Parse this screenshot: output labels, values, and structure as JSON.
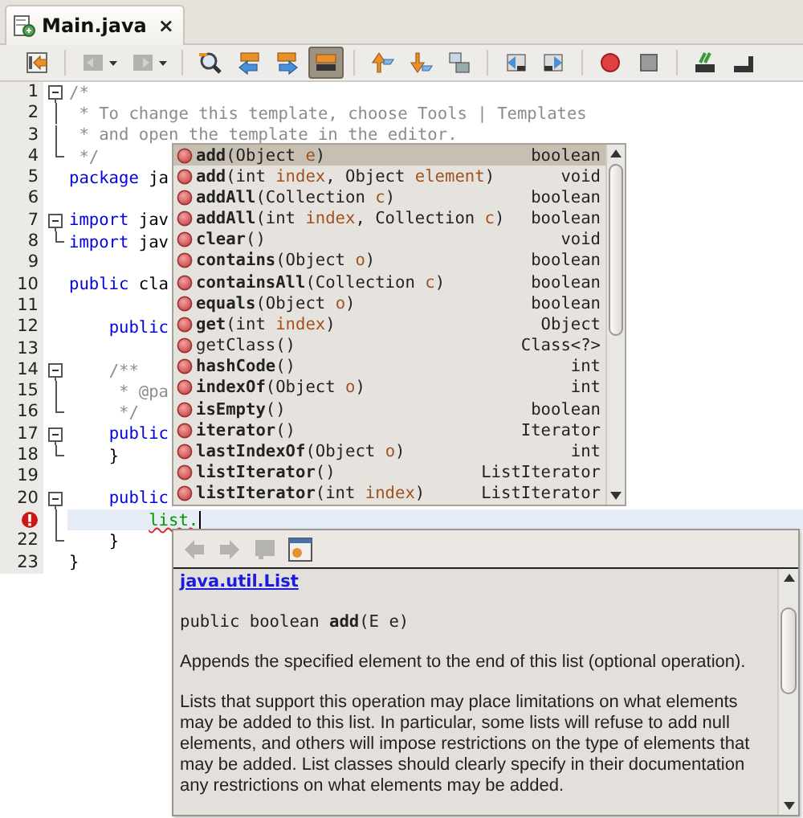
{
  "tab": {
    "title": "Main.java",
    "close": "×",
    "selected": true
  },
  "toolbar": [
    {
      "kind": "button",
      "pressed": false,
      "disabled": false
    },
    {
      "kind": "separator"
    },
    {
      "kind": "dropdown",
      "pressed": false,
      "disabled": true
    },
    {
      "kind": "dropdown",
      "pressed": false,
      "disabled": true
    },
    {
      "kind": "separator"
    },
    {
      "kind": "button",
      "pressed": false,
      "disabled": false
    },
    {
      "kind": "button",
      "pressed": false,
      "disabled": false
    },
    {
      "kind": "button",
      "pressed": false,
      "disabled": false
    },
    {
      "kind": "button",
      "pressed": true,
      "disabled": false
    },
    {
      "kind": "separator"
    },
    {
      "kind": "button",
      "pressed": false,
      "disabled": false
    },
    {
      "kind": "button",
      "pressed": false,
      "disabled": false
    },
    {
      "kind": "button",
      "pressed": false,
      "disabled": false
    },
    {
      "kind": "separator"
    },
    {
      "kind": "button",
      "pressed": false,
      "disabled": false
    },
    {
      "kind": "button",
      "pressed": false,
      "disabled": false
    },
    {
      "kind": "separator"
    },
    {
      "kind": "button",
      "pressed": false,
      "disabled": false
    },
    {
      "kind": "button",
      "pressed": false,
      "disabled": false
    },
    {
      "kind": "separator"
    },
    {
      "kind": "button",
      "pressed": false,
      "disabled": false
    },
    {
      "kind": "button",
      "pressed": false,
      "disabled": false
    }
  ],
  "editor": {
    "lines": [
      {
        "number": "1",
        "fold": {
          "kind": "start"
        },
        "current": false,
        "error": false,
        "tokens": [
          {
            "text": "/*",
            "kind": "comment"
          }
        ]
      },
      {
        "number": "2",
        "fold": {
          "kind": "line"
        },
        "current": false,
        "error": false,
        "tokens": [
          {
            "text": " * To change this template, choose Tools | Templates",
            "kind": "comment"
          }
        ]
      },
      {
        "number": "3",
        "fold": {
          "kind": "line"
        },
        "current": false,
        "error": false,
        "tokens": [
          {
            "text": " * and open the template in the editor.",
            "kind": "comment"
          }
        ]
      },
      {
        "number": "4",
        "fold": {
          "kind": "end"
        },
        "current": false,
        "error": false,
        "tokens": [
          {
            "text": " */",
            "kind": "comment"
          }
        ]
      },
      {
        "number": "5",
        "current": false,
        "error": false,
        "tokens": [
          {
            "text": "package",
            "kind": "keyword"
          },
          {
            "text": " ja",
            "kind": "plain"
          }
        ]
      },
      {
        "number": "6",
        "current": false,
        "error": false
      },
      {
        "number": "7",
        "fold": {
          "kind": "start"
        },
        "current": false,
        "error": false,
        "tokens": [
          {
            "text": "import",
            "kind": "keyword"
          },
          {
            "text": " jav",
            "kind": "plain"
          }
        ]
      },
      {
        "number": "8",
        "fold": {
          "kind": "end"
        },
        "current": false,
        "error": false,
        "tokens": [
          {
            "text": "import",
            "kind": "keyword"
          },
          {
            "text": " jav",
            "kind": "plain"
          }
        ]
      },
      {
        "number": "9",
        "current": false,
        "error": false
      },
      {
        "number": "10",
        "current": false,
        "error": false,
        "tokens": [
          {
            "text": "public",
            "kind": "keyword"
          },
          {
            "text": " cla",
            "kind": "plain"
          }
        ]
      },
      {
        "number": "11",
        "current": false,
        "error": false
      },
      {
        "number": "12",
        "current": false,
        "error": false,
        "tokens": [
          {
            "text": "    public",
            "kind": "keyword"
          }
        ]
      },
      {
        "number": "13",
        "current": false,
        "error": false
      },
      {
        "number": "14",
        "fold": {
          "kind": "start"
        },
        "current": false,
        "error": false,
        "tokens": [
          {
            "text": "    /**",
            "kind": "comment"
          }
        ]
      },
      {
        "number": "15",
        "fold": {
          "kind": "line"
        },
        "current": false,
        "error": false,
        "tokens": [
          {
            "text": "     * @pa",
            "kind": "comment"
          }
        ]
      },
      {
        "number": "16",
        "fold": {
          "kind": "end"
        },
        "current": false,
        "error": false,
        "tokens": [
          {
            "text": "     */",
            "kind": "comment"
          }
        ]
      },
      {
        "number": "17",
        "fold": {
          "kind": "start"
        },
        "current": false,
        "error": false,
        "tokens": [
          {
            "text": "    public",
            "kind": "keyword"
          }
        ]
      },
      {
        "number": "18",
        "fold": {
          "kind": "end"
        },
        "current": false,
        "error": false,
        "tokens": [
          {
            "text": "    }",
            "kind": "plain"
          }
        ]
      },
      {
        "number": "19",
        "current": false,
        "error": false
      },
      {
        "number": "20",
        "fold": {
          "kind": "start"
        },
        "current": false,
        "error": false,
        "tokens": [
          {
            "text": "    public",
            "kind": "keyword"
          }
        ]
      },
      {
        "fold": {
          "kind": "line"
        },
        "current": true,
        "error": true,
        "tokens": [
          {
            "text": "        list.",
            "kind": "error"
          }
        ]
      },
      {
        "number": "22",
        "fold": {
          "kind": "end"
        },
        "current": false,
        "error": false,
        "tokens": [
          {
            "text": "    }",
            "kind": "plain"
          }
        ]
      },
      {
        "number": "23",
        "current": false,
        "error": false,
        "tokens": [
          {
            "text": "}",
            "kind": "plain"
          }
        ]
      }
    ]
  },
  "completion": {
    "items": [
      {
        "name": "add",
        "bold": true,
        "selected": true,
        "signature": [
          {
            "text": "(Object ",
            "kind": "type"
          },
          {
            "text": "e",
            "kind": "param"
          },
          {
            "text": ")",
            "kind": "type"
          }
        ],
        "returns": "boolean"
      },
      {
        "name": "add",
        "bold": true,
        "selected": false,
        "signature": [
          {
            "text": "(int ",
            "kind": "type"
          },
          {
            "text": "index",
            "kind": "param"
          },
          {
            "text": ", Object ",
            "kind": "type"
          },
          {
            "text": "element",
            "kind": "param"
          },
          {
            "text": ")",
            "kind": "type"
          }
        ],
        "returns": "void"
      },
      {
        "name": "addAll",
        "bold": true,
        "selected": false,
        "signature": [
          {
            "text": "(Collection ",
            "kind": "type"
          },
          {
            "text": "c",
            "kind": "param"
          },
          {
            "text": ")",
            "kind": "type"
          }
        ],
        "returns": "boolean"
      },
      {
        "name": "addAll",
        "bold": true,
        "selected": false,
        "signature": [
          {
            "text": "(int ",
            "kind": "type"
          },
          {
            "text": "index",
            "kind": "param"
          },
          {
            "text": ", Collection ",
            "kind": "type"
          },
          {
            "text": "c",
            "kind": "param"
          },
          {
            "text": ")",
            "kind": "type"
          }
        ],
        "returns": "boolean"
      },
      {
        "name": "clear",
        "bold": true,
        "selected": false,
        "signature": [
          {
            "text": "()",
            "kind": "type"
          }
        ],
        "returns": "void"
      },
      {
        "name": "contains",
        "bold": true,
        "selected": false,
        "signature": [
          {
            "text": "(Object ",
            "kind": "type"
          },
          {
            "text": "o",
            "kind": "param"
          },
          {
            "text": ")",
            "kind": "type"
          }
        ],
        "returns": "boolean"
      },
      {
        "name": "containsAll",
        "bold": true,
        "selected": false,
        "signature": [
          {
            "text": "(Collection ",
            "kind": "type"
          },
          {
            "text": "c",
            "kind": "param"
          },
          {
            "text": ")",
            "kind": "type"
          }
        ],
        "returns": "boolean"
      },
      {
        "name": "equals",
        "bold": true,
        "selected": false,
        "signature": [
          {
            "text": "(Object ",
            "kind": "type"
          },
          {
            "text": "o",
            "kind": "param"
          },
          {
            "text": ")",
            "kind": "type"
          }
        ],
        "returns": "boolean"
      },
      {
        "name": "get",
        "bold": true,
        "selected": false,
        "signature": [
          {
            "text": "(int ",
            "kind": "type"
          },
          {
            "text": "index",
            "kind": "param"
          },
          {
            "text": ")",
            "kind": "type"
          }
        ],
        "returns": "Object"
      },
      {
        "name": "getClass",
        "bold": false,
        "selected": false,
        "signature": [
          {
            "text": "()",
            "kind": "type"
          }
        ],
        "returns": "Class<?>"
      },
      {
        "name": "hashCode",
        "bold": true,
        "selected": false,
        "signature": [
          {
            "text": "()",
            "kind": "type"
          }
        ],
        "returns": "int"
      },
      {
        "name": "indexOf",
        "bold": true,
        "selected": false,
        "signature": [
          {
            "text": "(Object ",
            "kind": "type"
          },
          {
            "text": "o",
            "kind": "param"
          },
          {
            "text": ")",
            "kind": "type"
          }
        ],
        "returns": "int"
      },
      {
        "name": "isEmpty",
        "bold": true,
        "selected": false,
        "signature": [
          {
            "text": "()",
            "kind": "type"
          }
        ],
        "returns": "boolean"
      },
      {
        "name": "iterator",
        "bold": true,
        "selected": false,
        "signature": [
          {
            "text": "()",
            "kind": "type"
          }
        ],
        "returns": "Iterator"
      },
      {
        "name": "lastIndexOf",
        "bold": true,
        "selected": false,
        "signature": [
          {
            "text": "(Object ",
            "kind": "type"
          },
          {
            "text": "o",
            "kind": "param"
          },
          {
            "text": ")",
            "kind": "type"
          }
        ],
        "returns": "int"
      },
      {
        "name": "listIterator",
        "bold": true,
        "selected": false,
        "signature": [
          {
            "text": "()",
            "kind": "type"
          }
        ],
        "returns": "ListIterator"
      },
      {
        "name": "listIterator",
        "bold": true,
        "selected": false,
        "signature": [
          {
            "text": "(int ",
            "kind": "type"
          },
          {
            "text": "index",
            "kind": "param"
          },
          {
            "text": ")",
            "kind": "type"
          }
        ],
        "returns": "ListIterator"
      }
    ]
  },
  "documentation": {
    "toolbar": [
      {
        "disabled": true
      },
      {
        "disabled": true
      },
      {
        "disabled": true
      },
      {
        "disabled": false
      }
    ],
    "link": "java.util.List",
    "signature": "public boolean **add**(E e)",
    "paragraphs": [
      "Appends the specified element to the end of this list (optional operation).",
      "Lists that support this operation may place limitations on what elements may be added to this list. In particular, some lists will refuse to add null elements, and others will impose restrictions on the type of elements that may be added. List classes should clearly specify in their documentation any restrictions on what elements may be added."
    ]
  }
}
